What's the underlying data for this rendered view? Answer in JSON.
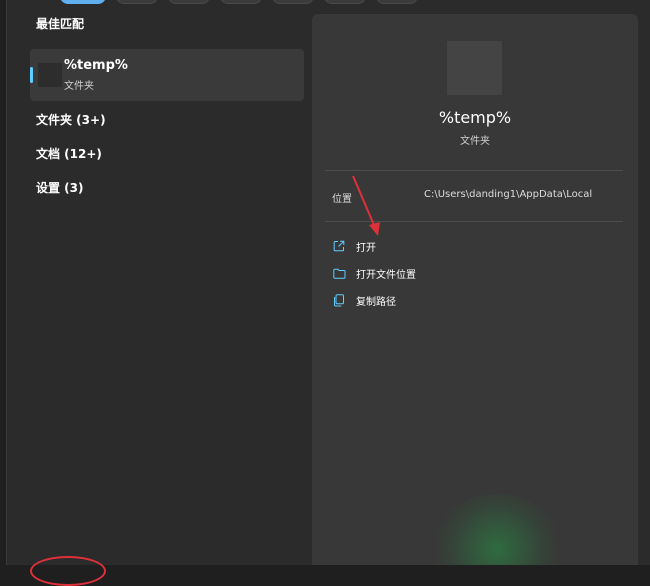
{
  "left": {
    "best_match_title": "最佳匹配",
    "best_item": {
      "name": "%temp%",
      "type": "文件夹"
    },
    "categories": [
      "文件夹 (3+)",
      "文档 (12+)",
      "设置 (3)"
    ]
  },
  "preview": {
    "title": "%temp%",
    "subtitle": "文件夹",
    "location_label": "位置",
    "location_value": "C:\\Users\\danding1\\AppData\\Local",
    "actions": [
      {
        "label": "打开",
        "icon": "open-external-icon"
      },
      {
        "label": "打开文件位置",
        "icon": "folder-icon"
      },
      {
        "label": "复制路径",
        "icon": "copy-icon"
      }
    ]
  },
  "colors": {
    "accent": "#60cdff",
    "annotation_red": "#e0303a"
  }
}
